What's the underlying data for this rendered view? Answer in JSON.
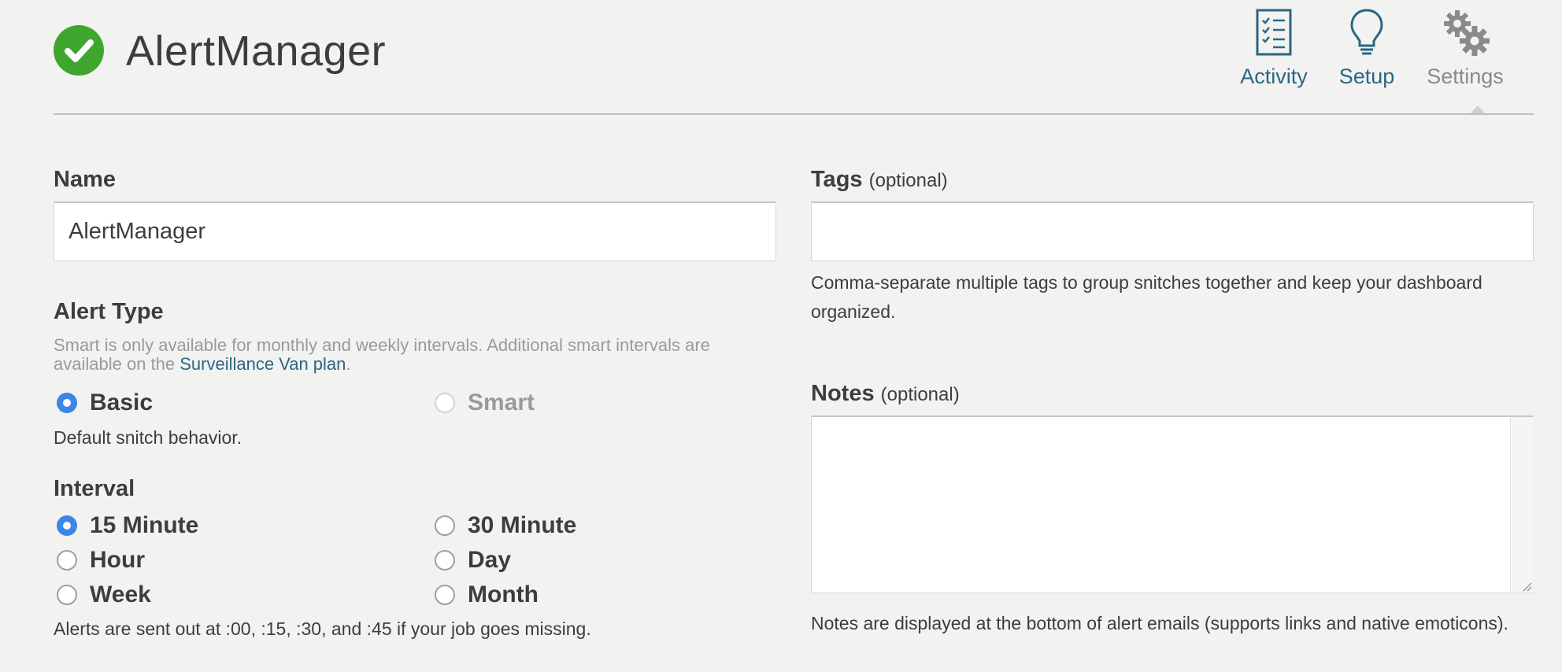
{
  "app": {
    "title": "AlertManager"
  },
  "nav": [
    {
      "label": "Activity",
      "icon": "checklist-icon"
    },
    {
      "label": "Setup",
      "icon": "lightbulb-icon"
    },
    {
      "label": "Settings",
      "icon": "gears-icon",
      "active": true
    }
  ],
  "name": {
    "label": "Name",
    "value": "AlertManager"
  },
  "alert_type": {
    "label": "Alert Type",
    "note_prefix": "Smart is only available for monthly and weekly intervals. Additional smart intervals are available on the ",
    "note_link": "Surveillance Van plan",
    "note_suffix": ".",
    "options": [
      {
        "label": "Basic",
        "checked": true,
        "disabled": false
      },
      {
        "label": "Smart",
        "checked": false,
        "disabled": true
      }
    ],
    "help": "Default snitch behavior."
  },
  "interval": {
    "label": "Interval",
    "options": [
      {
        "label": "15 Minute",
        "checked": true
      },
      {
        "label": "30 Minute",
        "checked": false
      },
      {
        "label": "Hour",
        "checked": false
      },
      {
        "label": "Day",
        "checked": false
      },
      {
        "label": "Week",
        "checked": false
      },
      {
        "label": "Month",
        "checked": false
      }
    ],
    "help": "Alerts are sent out at :00, :15, :30, and :45 if your job goes missing."
  },
  "tags": {
    "label": "Tags",
    "optional": "(optional)",
    "value": "",
    "help": "Comma-separate multiple tags to group snitches together and keep your dashboard organized."
  },
  "notes": {
    "label": "Notes",
    "optional": "(optional)",
    "value": "",
    "help": "Notes are displayed at the bottom of alert emails (supports links and native emoticons)."
  },
  "colors": {
    "accent": "#2b6684",
    "success": "#3fa62d",
    "radio": "#3b86e6",
    "muted": "#9a9a9a"
  }
}
